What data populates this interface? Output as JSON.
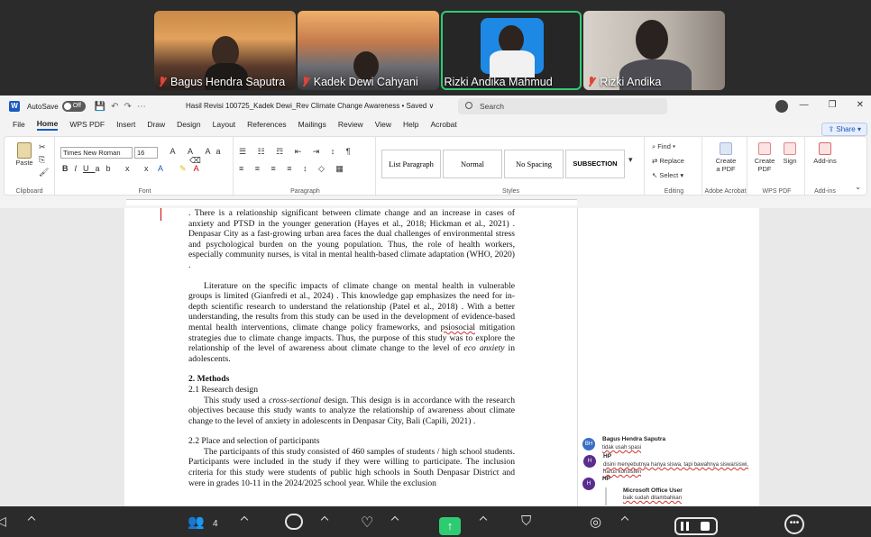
{
  "participants": [
    {
      "name": "Bagus Hendra Saputra",
      "muted": true,
      "active": false
    },
    {
      "name": "Kadek Dewi Cahyani",
      "muted": true,
      "active": false
    },
    {
      "name": "Rizki Andika Mahmud",
      "muted": false,
      "active": true
    },
    {
      "name": "Rizki Andika",
      "muted": true,
      "active": false
    }
  ],
  "titlebar": {
    "app_logo": "W",
    "autosave_label": "AutoSave",
    "autosave_state": "Off",
    "doc_title": "Hasil Revisi 100725_Kadek Dewi_Rev Climate Change Awareness • Saved ∨",
    "search_placeholder": "Search"
  },
  "menu": [
    "File",
    "Home",
    "WPS PDF",
    "Insert",
    "Draw",
    "Design",
    "Layout",
    "References",
    "Mailings",
    "Review",
    "View",
    "Help",
    "Acrobat"
  ],
  "menu_selected": "Home",
  "share_label": "Share",
  "ribbon": {
    "clipboard": {
      "paste": "Paste",
      "label": "Clipboard"
    },
    "font": {
      "name": "Times New Roman",
      "size": "16",
      "label": "Font"
    },
    "paragraph": {
      "label": "Paragraph"
    },
    "styles": {
      "items": [
        "List Paragraph",
        "Normal",
        "No Spacing",
        "SUBSECTION"
      ],
      "label": "Styles"
    },
    "editing": {
      "find": "Find",
      "replace": "Replace",
      "select": "Select",
      "label": "Editing"
    },
    "adobe": {
      "create": "Create",
      "pdf": "a PDF",
      "label": "Adobe Acrobat"
    },
    "wps": {
      "create": "Create",
      "pdf": "PDF",
      "sign": "Sign",
      "label": "WPS PDF"
    },
    "addins": {
      "btn": "Add-ins",
      "label": "Add-ins"
    }
  },
  "document": {
    "para1": ". There is a relationship significant between climate change and an increase in cases of anxiety and PTSD in the younger generation (Hayes et al., 2018; Hickman et al., 2021) . Denpasar City as a fast-growing urban area faces the dual challenges of environmental stress and psychological burden on the young population. Thus, the role of health workers, especially community nurses, is vital in mental health-based climate adaptation (WHO, 2020) .",
    "para2_a": "Literature on the specific impacts of climate change on mental health in vulnerable groups is limited (Gianfredi et al., 2024) . This knowledge gap emphasizes the need for in-depth scientific research to understand the relationship (Patel et al., 2018) . With a better understanding, the results from this study can be used in the development of evidence-based mental health interventions, climate change policy frameworks, and ",
    "para2_squig": "psiosocial",
    "para2_b": " mitigation strategies due to climate change impacts. Thus, the purpose of this study was to explore the relationship of the level of awareness about climate change to the level of ",
    "para2_em": "eco anxiety",
    "para2_c": " in adolescents.",
    "h_methods": "2.    Methods",
    "h_21": "2.1  Research design",
    "para3_a": "This study used a ",
    "para3_em": "cross-sectional",
    "para3_b": " design. This design is in accordance with the research objectives because this study wants to analyze the relationship of awareness about climate change to the level of anxiety in adolescents in Denpasar City, Bali (Capili, 2021) .",
    "h_22": "2.2  Place and selection of participants",
    "para4": "The participants of this study consisted of 460 samples of students / high school students. Participants were included in the study if they were willing to participate. The inclusion criteria for this study were students of public high schools in South Denpasar District and were in grades 10-11 in the 2024/2025 school year. While the exclusion"
  },
  "comments": [
    {
      "initials": "H",
      "author": "HP",
      "lines": [
        "disini menyebutnya hanya siswa, tapi bawahnya siswa/siswi,",
        "harus konsisten"
      ],
      "color": "#5b2d8e"
    },
    {
      "initials": "",
      "author": "Microsoft Office User",
      "lines": [
        "baik sudah ditambahkan"
      ],
      "color": "#ffffff"
    },
    {
      "initials": "BH",
      "author": "Bagus Hendra Saputra",
      "lines": [
        "tidak usah spasi"
      ],
      "color": "#3a6fc4"
    },
    {
      "initials": "H",
      "author": "HP",
      "lines": [],
      "color": "#5b2d8e"
    }
  ],
  "bottombar": {
    "participant_count": "4"
  }
}
